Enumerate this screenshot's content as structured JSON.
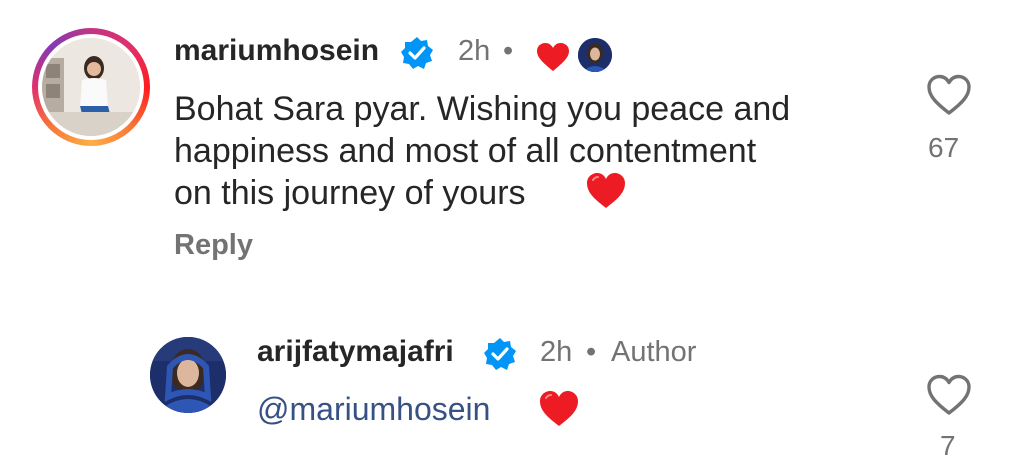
{
  "comments": [
    {
      "username": "mariumhosein",
      "time": "2h",
      "separator": "•",
      "text": "Bohat Sara pyar. Wishing you peace and happiness and most of all contentment on this journey of yours",
      "text_lines": [
        "Bohat Sara pyar. Wishing you peace and",
        "happiness and most of all contentment",
        "on this journey of yours"
      ],
      "emoji": "❤️",
      "reply_label": "Reply",
      "like_count": "67",
      "liked_by_author": true
    },
    {
      "username": "arijfatymajafri",
      "time": "2h",
      "separator": "•",
      "badge": "Author",
      "mention": "@mariumhosein",
      "emoji": "❤️",
      "like_count": "7"
    }
  ],
  "icons": {
    "verified": "verified-badge-icon",
    "like": "heart-outline-icon",
    "liked_by_author": "red-heart-icon"
  },
  "colors": {
    "text": "#262626",
    "secondary": "#737373",
    "verified": "#0095f6",
    "heart": "#ed1c24"
  }
}
